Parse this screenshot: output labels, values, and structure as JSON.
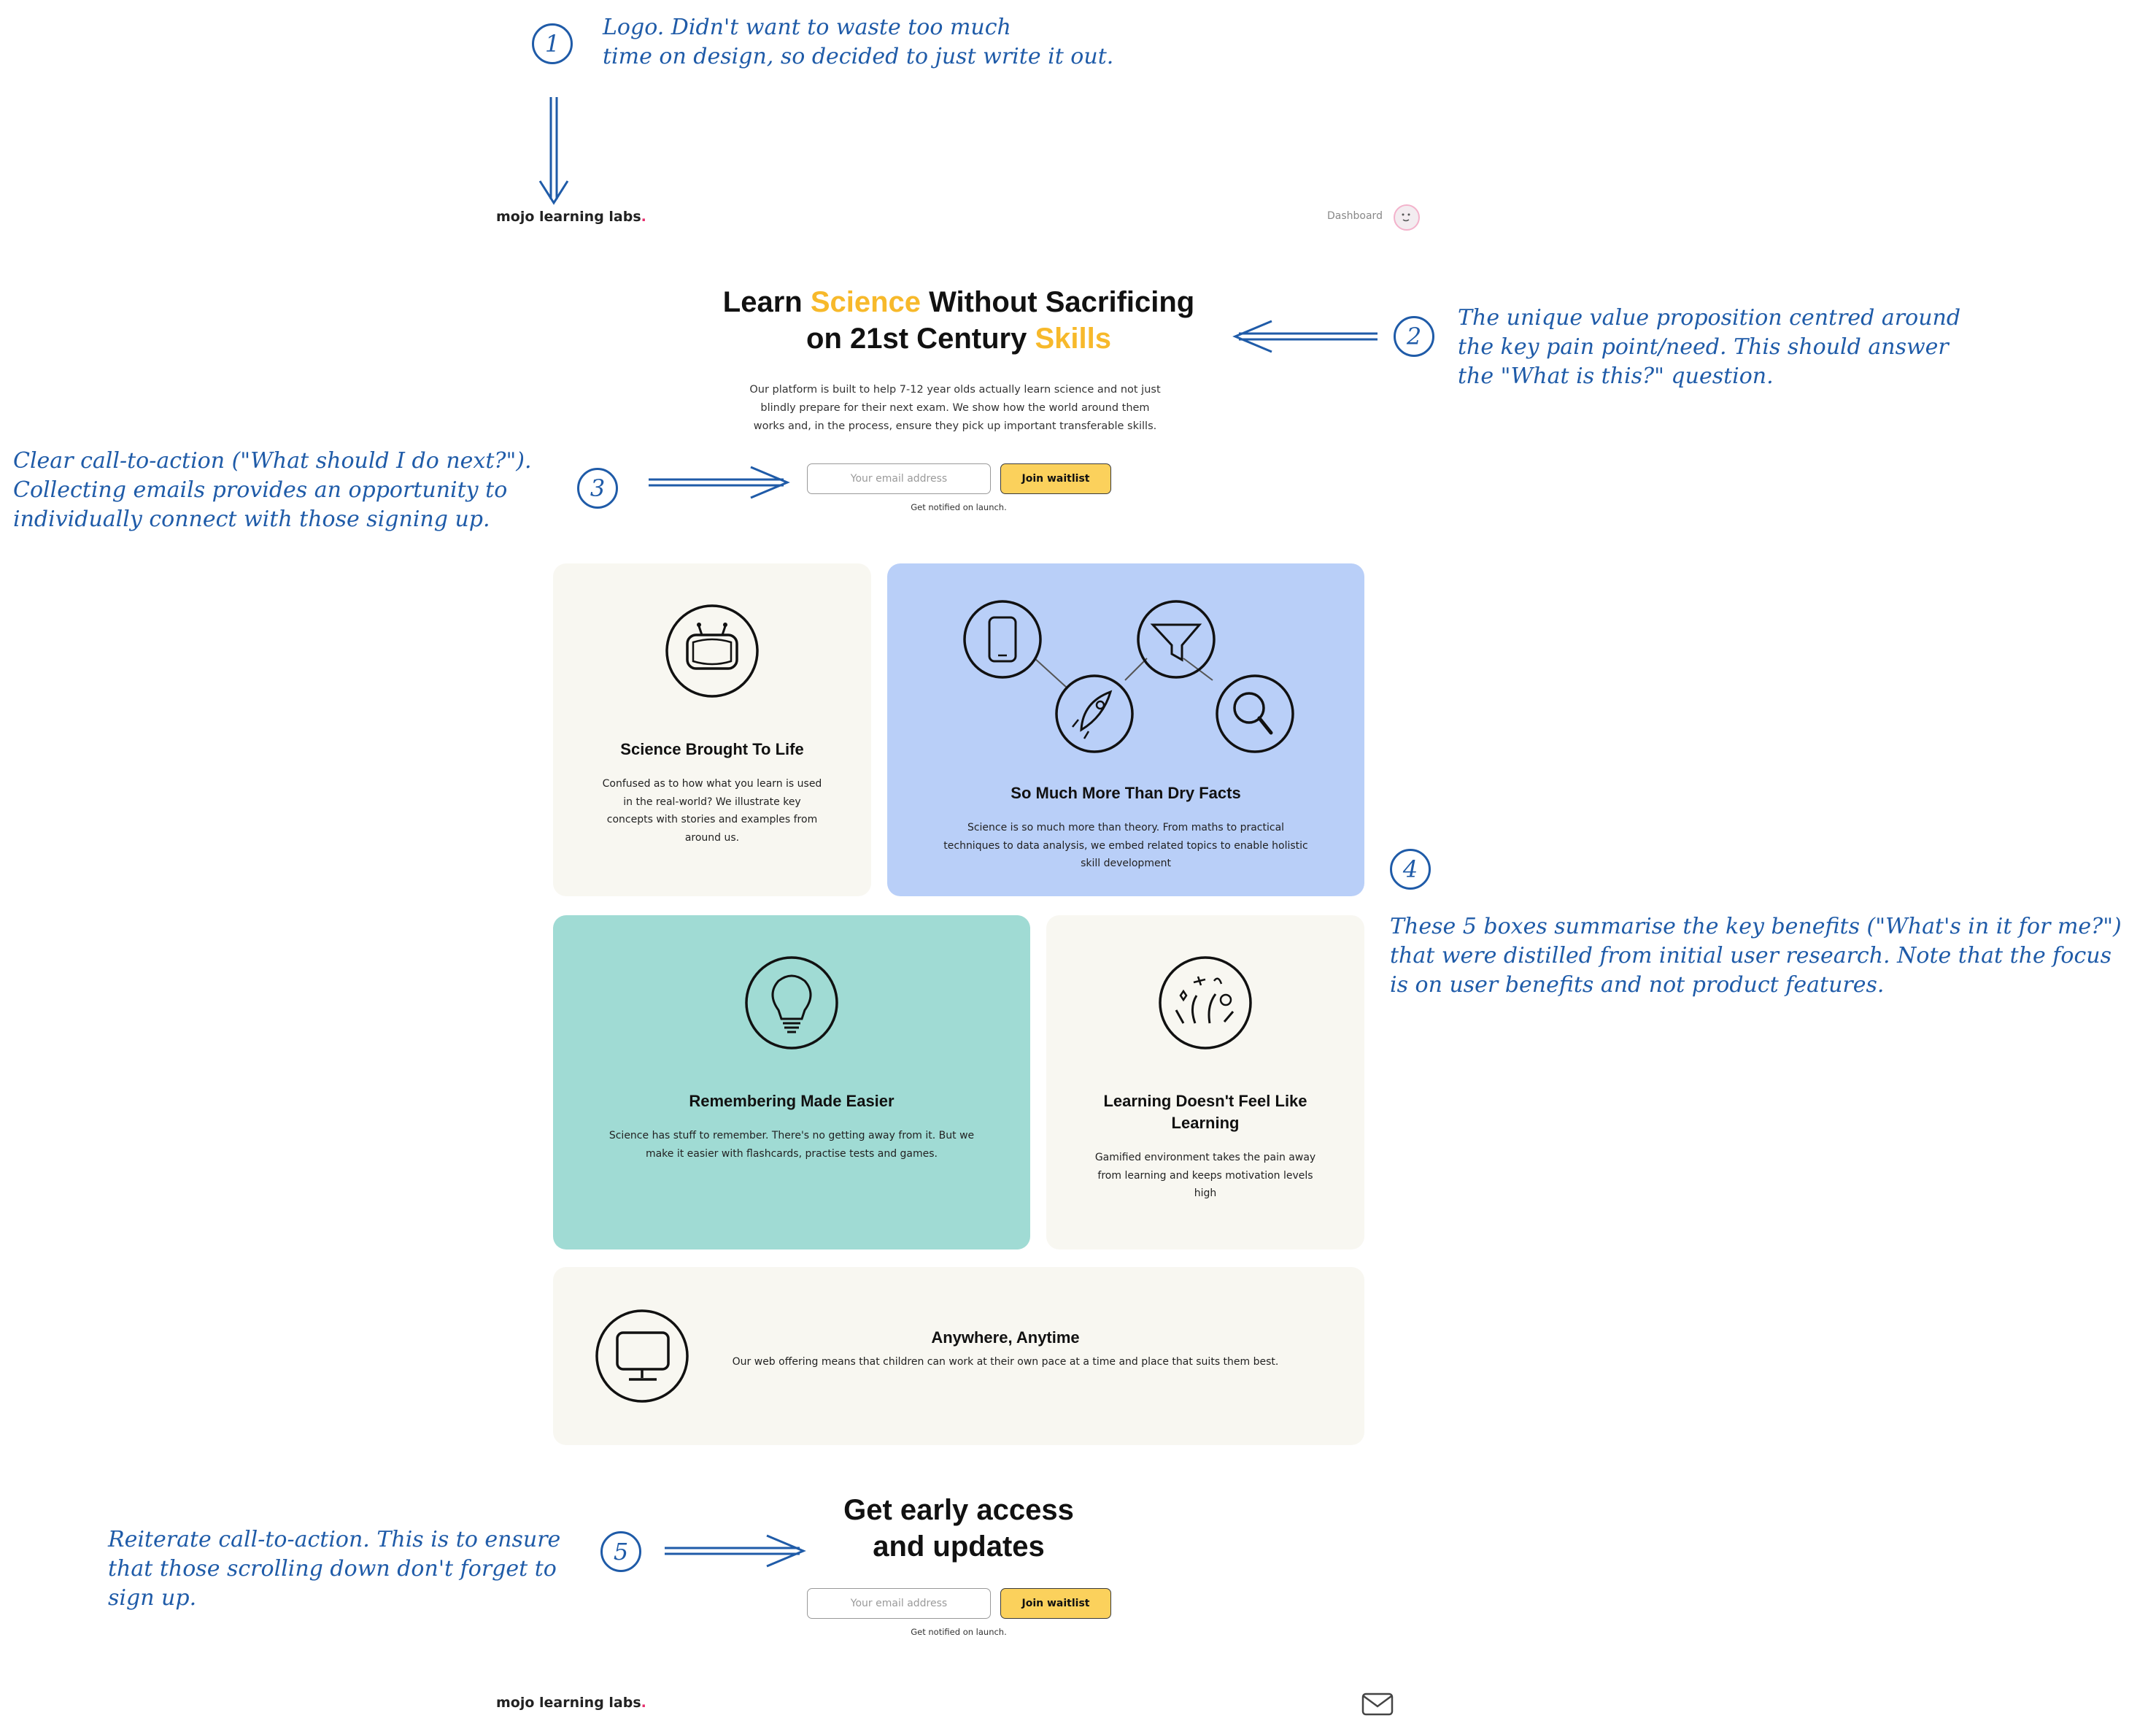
{
  "annotations": {
    "a1": [
      "Logo. Didn't want to waste too much",
      "time on design, so decided to just write it out."
    ],
    "a2": [
      "The unique value proposition centred around",
      "the key pain point/need. This should answer",
      "the \"What is this?\" question."
    ],
    "a3": [
      "Clear call-to-action (\"What should I do next?\").",
      "Collecting emails provides an opportunity to",
      "individually connect with those signing up."
    ],
    "a4": [
      "These 5 boxes summarise the key benefits (\"What's in it for me?\")",
      "that were distilled from initial user research. Note that the focus",
      "is on user benefits and not product features."
    ],
    "a5": [
      "Reiterate call-to-action. This is to ensure",
      "that those scrolling down don't forget to",
      "sign up."
    ],
    "numbers": [
      "1",
      "2",
      "3",
      "4",
      "5"
    ]
  },
  "header": {
    "logo": "mojo learning labs",
    "logo_dot": ".",
    "dashboard": "Dashboard"
  },
  "hero": {
    "title_part1": "Learn ",
    "title_accent1": "Science",
    "title_part2": " Without Sacrificing",
    "title_part3": "on 21st Century ",
    "title_accent2": "Skills",
    "description": [
      "Our platform is built to help 7-12 year olds actually learn science and not just",
      "blindly prepare for their next exam. We show how the world around them",
      "works and, in the process, ensure they pick up important transferable skills."
    ],
    "email_placeholder": "Your email address",
    "button": "Join waitlist",
    "note": "Get notified on launch."
  },
  "cards": [
    {
      "title": "Science Brought To Life",
      "text": [
        "Confused as to how what you learn is used",
        "in the real-world? We illustrate key",
        "concepts with stories and examples from",
        "around us."
      ],
      "icon": "tv-robot-icon",
      "bg": "#f8f7f1"
    },
    {
      "title": "So Much More Than Dry Facts",
      "text": [
        "Science is so much more than theory. From maths to practical",
        "techniques to data analysis, we embed related topics to enable holistic",
        "skill development"
      ],
      "icon": "skills-network-icon",
      "bg": "#b9cff8"
    },
    {
      "title": "Remembering Made Easier",
      "text": [
        "Science has stuff to remember. There's no getting away from it. But we",
        "make it easier with flashcards, practise tests and games."
      ],
      "icon": "lightbulb-icon",
      "bg": "#a0dbd4"
    },
    {
      "title": [
        "Learning Doesn't Feel Like",
        "Learning"
      ],
      "text": [
        "Gamified environment takes the pain away",
        "from learning and keeps motivation levels",
        "high"
      ],
      "icon": "fireworks-icon",
      "bg": "#f8f7f1"
    },
    {
      "title": "Anywhere, Anytime",
      "text": [
        "Our web offering means that children can work at their own pace at a time and place that suits them best."
      ],
      "icon": "monitor-icon",
      "bg": "#f8f7f1"
    }
  ],
  "cta": {
    "title": [
      "Get early access",
      "and updates"
    ],
    "email_placeholder": "Your email address",
    "button": "Join waitlist",
    "note": "Get notified on launch."
  },
  "footer": {
    "logo": "mojo learning labs",
    "logo_dot": ".",
    "icon": "mail-icon"
  },
  "colors": {
    "accent": "#f7b92b",
    "button": "#fbd15c",
    "annotation": "#1f5ba8",
    "logo_dot": "#e62d6c",
    "card_beige": "#f8f7f1",
    "card_blue": "#b9cff8",
    "card_teal": "#a0dbd4"
  }
}
